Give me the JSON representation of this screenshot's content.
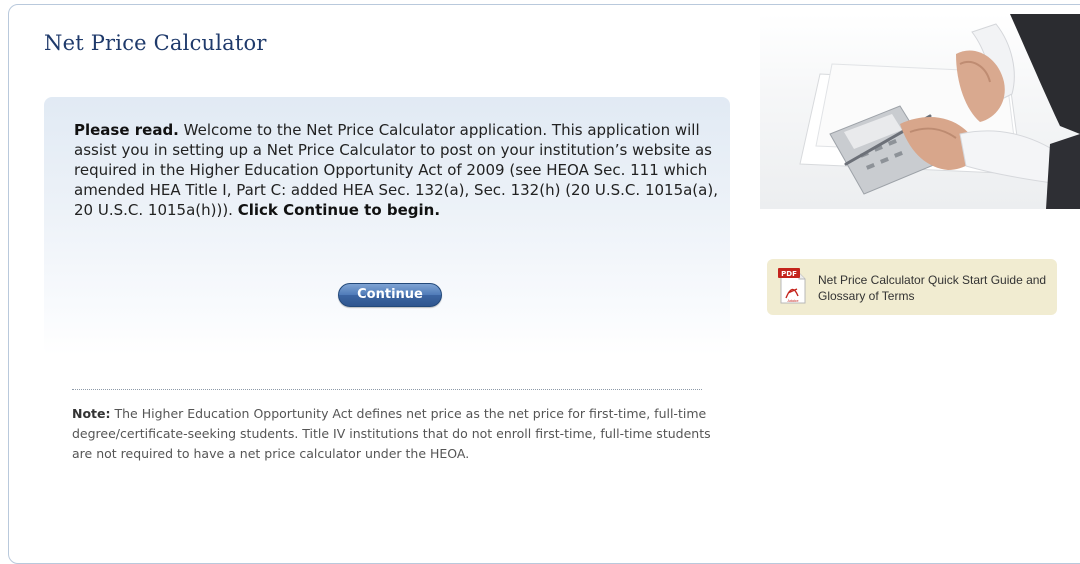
{
  "header": {
    "title": "Net Price Calculator"
  },
  "intro": {
    "lead": "Please read.",
    "body": " Welcome to the Net Price Calculator application. This application will assist you in setting up a Net Price Calculator to post on your institution’s website as required in the Higher Education Opportunity Act of 2009 (see HEOA Sec. 111 which amended HEA Title I, Part C: added HEA Sec. 132(a), Sec. 132(h) (20 U.S.C. 1015a(a), 20 U.S.C. 1015a(h))). ",
    "cta": "Click Continue to begin."
  },
  "continue_button": {
    "label": "Continue"
  },
  "note": {
    "lead": "Note:",
    "body": " The Higher Education Opportunity Act defines net price as the net price for first-time, full-time degree/certificate-seeking students. Title IV institutions that do not enroll first-time, full-time students are not required to have a net price calculator under the HEOA."
  },
  "sidebar": {
    "guide_link": {
      "icon_text": "PDF",
      "icon_brand": "Adobe",
      "label": "Net Price Calculator Quick Start Guide and Glossary of Terms"
    }
  },
  "colors": {
    "title": "#1f3a6b",
    "frame_border": "#b9c9dc",
    "button": "#3c65a2",
    "guide_background": "#f1ecd1",
    "pdf_red": "#c4241c"
  }
}
